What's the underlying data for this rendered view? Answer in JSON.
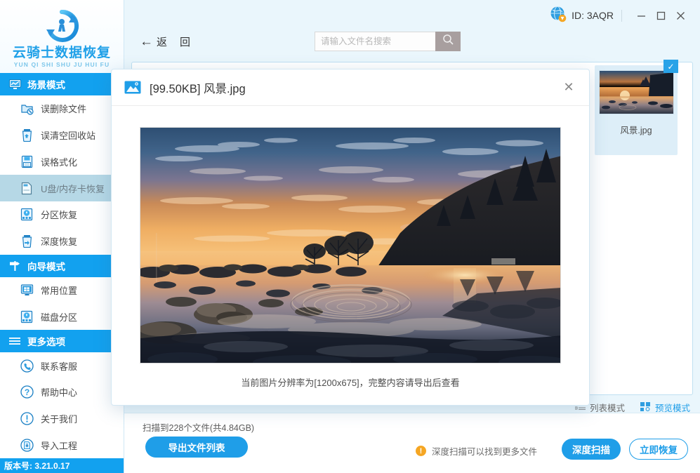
{
  "app": {
    "logo_title": "云骑士数据恢复",
    "logo_subtitle": "YUN QI SHI SHU JU HUI FU",
    "version_label": "版本号: 3.21.0.17",
    "accent_color": "#1f9ee8",
    "sidebar_header_color": "#12a1ef",
    "active_item_color": "#b6d8e6"
  },
  "titlebar": {
    "account_icon": "globe-user-icon",
    "id_label": "ID: 3AQR",
    "minimize": "—",
    "maximize": "▢",
    "close": "✕"
  },
  "toolbar": {
    "back_arrow": "←",
    "back_label_1": "返",
    "back_label_2": "回",
    "search_placeholder": "请输入文件名搜索",
    "search_value": "",
    "search_icon": "magnifier-icon"
  },
  "sidebar": {
    "groups": [
      {
        "label": "场景模式",
        "icon": "monitor-chart-icon",
        "items": [
          {
            "label": "误删除文件",
            "icon": "deleted-file-icon",
            "active": false
          },
          {
            "label": "误清空回收站",
            "icon": "recycle-bin-icon",
            "active": false
          },
          {
            "label": "误格式化",
            "icon": "format-disk-icon",
            "active": false
          },
          {
            "label": "U盘/内存卡恢复",
            "icon": "usb-card-icon",
            "active": true
          },
          {
            "label": "分区恢复",
            "icon": "partition-icon",
            "active": false
          },
          {
            "label": "深度恢复",
            "icon": "deep-recovery-icon",
            "active": false
          }
        ]
      },
      {
        "label": "向导模式",
        "icon": "signpost-icon",
        "items": [
          {
            "label": "常用位置",
            "icon": "windows-icon",
            "active": false
          },
          {
            "label": "磁盘分区",
            "icon": "disk-partition-icon",
            "active": false
          }
        ]
      },
      {
        "label": "更多选项",
        "icon": "hamburger-icon",
        "items": [
          {
            "label": "联系客服",
            "icon": "phone-icon",
            "active": false
          },
          {
            "label": "帮助中心",
            "icon": "question-icon",
            "active": false
          },
          {
            "label": "关于我们",
            "icon": "info-icon",
            "active": false
          },
          {
            "label": "导入工程",
            "icon": "import-project-icon",
            "active": false
          }
        ]
      }
    ]
  },
  "content": {
    "files": [
      {
        "name": "风景.jpg",
        "selected": true,
        "thumb": "sunset-lake-thumb"
      }
    ],
    "view_modes": [
      {
        "label": "列表模式",
        "icon": "list-mode-icon",
        "active": false
      },
      {
        "label": "预览模式",
        "icon": "grid-mode-icon",
        "active": true
      }
    ]
  },
  "status": {
    "scan_summary": "扫描到228个文件(共4.84GB)",
    "export_button": "导出文件列表",
    "hint_icon": "warning-icon",
    "hint_text": "深度扫描可以找到更多文件",
    "deep_scan_button": "深度扫描",
    "recover_button": "立即恢复"
  },
  "modal": {
    "icon": "image-file-icon",
    "title": "[99.50KB] 风景.jpg",
    "close_label": "✕",
    "caption": "当前图片分辨率为[1200x675]，完整内容请导出后查看",
    "preview_alt": "sunset-lake-preview"
  }
}
